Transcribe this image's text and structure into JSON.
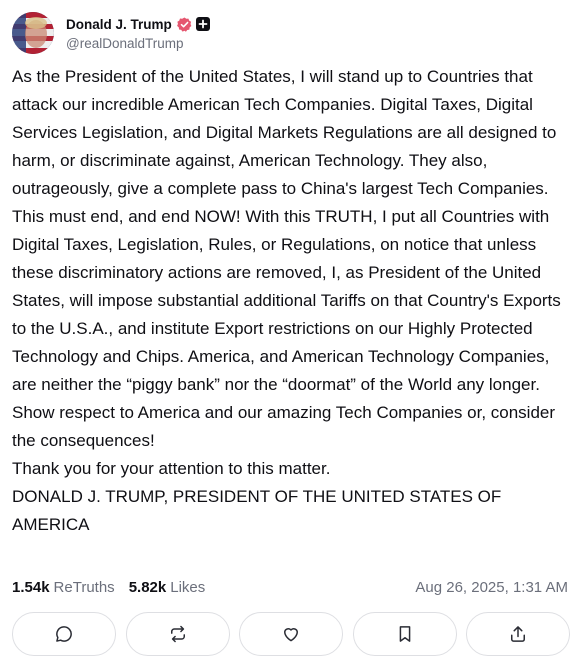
{
  "author": {
    "display_name": "Donald J. Trump",
    "handle": "@realDonaldTrump",
    "verified_color": "#e5566f"
  },
  "post": {
    "paragraphs": [
      "As the President of the United States, I will stand up to Countries that attack our incredible American Tech Companies. Digital Taxes, Digital Services Legislation, and Digital Markets Regulations are all designed to harm, or discriminate against, American Technology. They also, outrageously, give a complete pass to China's largest Tech Companies. This must end, and end NOW! With this TRUTH, I put all Countries with Digital Taxes, Legislation, Rules, or Regulations, on notice that unless these discriminatory actions are removed, I, as President of the United States, will impose substantial additional Tariffs on that Country's Exports to the U.S.A., and institute Export restrictions on our Highly Protected Technology and Chips. America, and American Technology Companies, are neither the “piggy bank” nor the “doormat” of the World any longer. Show respect to America and our amazing Tech Companies or, consider the consequences!",
      "Thank you for your attention to this matter.",
      "DONALD J. TRUMP, PRESIDENT OF THE UNITED STATES OF AMERICA"
    ]
  },
  "stats": {
    "retruths_count": "1.54k",
    "retruths_label": "ReTruths",
    "likes_count": "5.82k",
    "likes_label": "Likes",
    "timestamp": "Aug 26, 2025, 1:31 AM"
  },
  "actions": {
    "icons": [
      "reply-icon",
      "retruth-icon",
      "like-icon",
      "bookmark-icon",
      "share-icon"
    ]
  }
}
